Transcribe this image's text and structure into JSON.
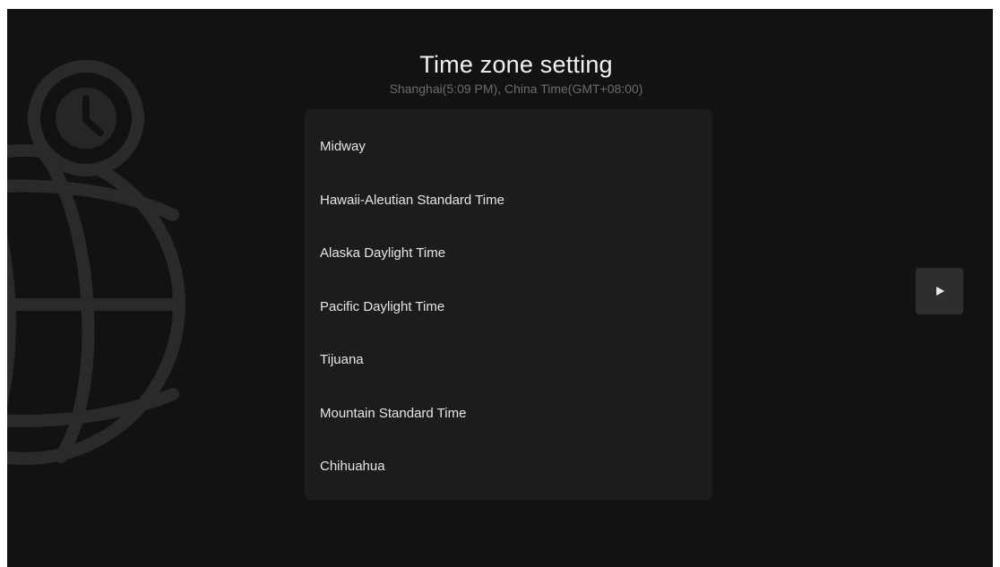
{
  "header": {
    "title": "Time zone setting",
    "subtitle": "Shanghai(5:09 PM), China Time(GMT+08:00)"
  },
  "timezones": [
    "Midway",
    "Hawaii-Aleutian Standard Time",
    "Alaska Daylight Time",
    "Pacific Daylight Time",
    "Tijuana",
    "Mountain Standard Time",
    "Chihuahua"
  ],
  "icons": {
    "background": "globe-clock-icon",
    "next": "play-icon"
  },
  "colors": {
    "background": "#121212",
    "panel": "#1c1c1e",
    "button": "#2e2e30",
    "text_primary": "#f2f2f2",
    "text_secondary": "#6d6d6d"
  }
}
